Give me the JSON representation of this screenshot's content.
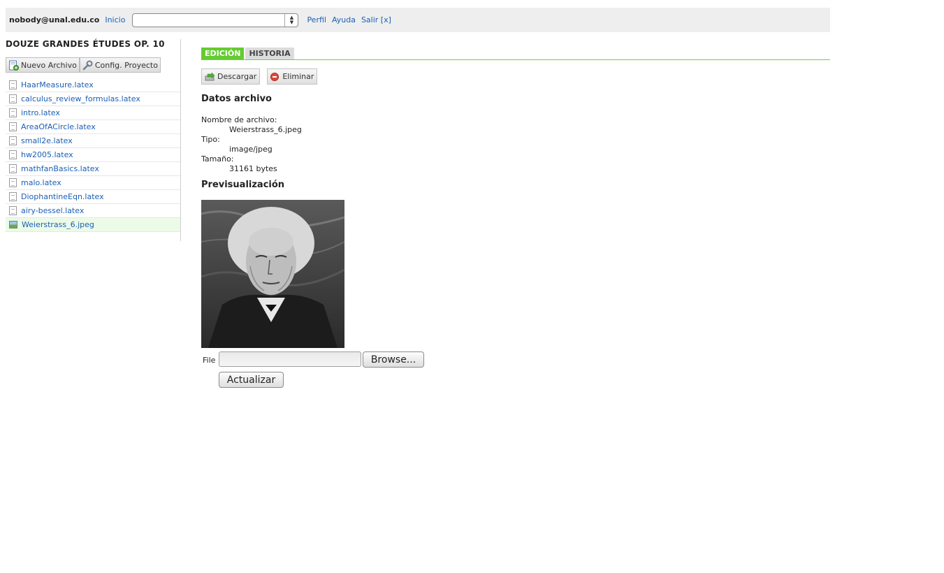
{
  "header": {
    "user": "nobody@unal.edu.co",
    "home_label": "Inicio",
    "select_value": "",
    "profile_label": "Perfil",
    "help_label": "Ayuda",
    "logout_label": "Salir [x]"
  },
  "sidebar": {
    "project_title": "DOUZE GRANDES ÉTUDES OP. 10",
    "new_file_label": "Nuevo Archivo",
    "config_label": "Config. Proyecto",
    "files": [
      {
        "name": "HaarMeasure.latex",
        "icon": "document-icon"
      },
      {
        "name": "calculus_review_formulas.latex",
        "icon": "document-icon"
      },
      {
        "name": "intro.latex",
        "icon": "document-icon"
      },
      {
        "name": "AreaOfACircle.latex",
        "icon": "document-icon"
      },
      {
        "name": "small2e.latex",
        "icon": "document-icon"
      },
      {
        "name": "hw2005.latex",
        "icon": "document-icon"
      },
      {
        "name": "mathfanBasics.latex",
        "icon": "document-icon"
      },
      {
        "name": "malo.latex",
        "icon": "document-icon"
      },
      {
        "name": "DiophantineEqn.latex",
        "icon": "document-icon"
      },
      {
        "name": "airy-bessel.latex",
        "icon": "document-icon"
      },
      {
        "name": "Weierstrass_6.jpeg",
        "icon": "image-file-icon",
        "selected": true
      }
    ]
  },
  "main": {
    "tabs": [
      {
        "label": "EDICIÓN",
        "active": true
      },
      {
        "label": "HISTORIA",
        "active": false
      }
    ],
    "download_label": "Descargar",
    "delete_label": "Eliminar",
    "file_data_heading": "Datos archivo",
    "filename_label": "Nombre de archivo:",
    "filename_value": "Weierstrass_6.jpeg",
    "type_label": "Tipo:",
    "type_value": "image/jpeg",
    "size_label": "Tamaño:",
    "size_value": "31161 bytes",
    "preview_heading": "Previsualización"
  },
  "upload": {
    "file_label": "File",
    "browse_label": "Browse...",
    "update_label": "Actualizar"
  },
  "colors": {
    "active_tab": "#64cc2f",
    "link": "#1a5fb4",
    "selected_row": "#ecfbe8"
  }
}
